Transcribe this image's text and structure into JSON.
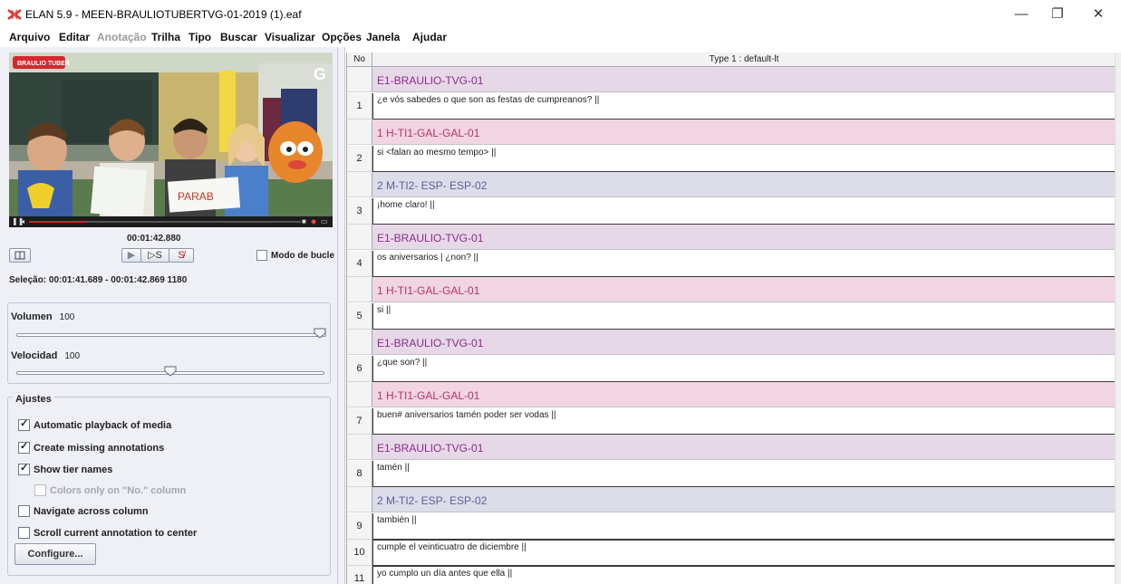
{
  "window": {
    "title": "ELAN 5.9 - MEEN-BRAULIOTUBERTVG-01-2019 (1).eaf",
    "minimize_glyph": "—",
    "restore_glyph": "❐",
    "close_glyph": "✕"
  },
  "menu": [
    {
      "label": "Arquivo",
      "enabled": true
    },
    {
      "label": "Editar",
      "enabled": true
    },
    {
      "label": "Anotação",
      "enabled": false
    },
    {
      "label": "Trilha",
      "enabled": true
    },
    {
      "label": "Tipo",
      "enabled": true
    },
    {
      "label": "Buscar",
      "enabled": true
    },
    {
      "label": "Visualizar",
      "enabled": true
    },
    {
      "label": "Opções",
      "enabled": true
    },
    {
      "label": "Janela",
      "enabled": true
    },
    {
      "label": "Ajudar",
      "enabled": true
    }
  ],
  "player": {
    "logo_text": "BRAULIO TUBER",
    "corner_logo": "G",
    "sign_text": "PARAB",
    "current_time": "00:01:42.880",
    "play_selection_label": "▷S",
    "clear_selection_label": "S̸",
    "loop_mode_label": "Modo de bucle",
    "loop_mode_checked": false,
    "selection_text": "Seleção: 00:01:41.689 - 00:01:42.869  1180"
  },
  "sliders": {
    "volume": {
      "label": "Volumen",
      "value": "100",
      "fraction": 1.0
    },
    "speed": {
      "label": "Velocidad",
      "value": "100",
      "fraction": 0.5
    }
  },
  "settings": {
    "title": "Ajustes",
    "options": [
      {
        "label": "Automatic playback of media",
        "checked": true,
        "enabled": true
      },
      {
        "label": "Create missing annotations",
        "checked": true,
        "enabled": true
      },
      {
        "label": "Show tier names",
        "checked": true,
        "enabled": true
      },
      {
        "label": "Colors only on \"No.\" column",
        "checked": false,
        "enabled": false
      },
      {
        "label": "Navigate across column",
        "checked": false,
        "enabled": true
      },
      {
        "label": "Scroll current annotation to center",
        "checked": false,
        "enabled": true
      }
    ],
    "configure_label": "Configure..."
  },
  "table": {
    "header_no": "No",
    "header_tier": "Type 1 : default-lt",
    "tier_colors": {
      "E1-BRAULIO-TVG-01": {
        "bg": "#e7d8e8",
        "fg": "#8a2c8c"
      },
      "1 H-TI1-GAL-GAL-01": {
        "bg": "#f2d5e2",
        "fg": "#b5346d"
      },
      "2 M-TI2- ESP- ESP-02": {
        "bg": "#dcdde9",
        "fg": "#5d5e9a"
      }
    },
    "rows": [
      {
        "kind": "tier",
        "text": "E1-BRAULIO-TVG-01"
      },
      {
        "kind": "ann",
        "no": "1",
        "text": "¿e vós sabedes o que son as festas de cumpreanos? ||"
      },
      {
        "kind": "tier",
        "text": "1 H-TI1-GAL-GAL-01"
      },
      {
        "kind": "ann",
        "no": "2",
        "text": "si <falan ao mesmo tempo> ||"
      },
      {
        "kind": "tier",
        "text": "2 M-TI2- ESP- ESP-02"
      },
      {
        "kind": "ann",
        "no": "3",
        "text": "¡home claro! ||"
      },
      {
        "kind": "tier",
        "text": "E1-BRAULIO-TVG-01"
      },
      {
        "kind": "ann",
        "no": "4",
        "text": "os aniversarios | ¿non? ||"
      },
      {
        "kind": "tier",
        "text": "1 H-TI1-GAL-GAL-01"
      },
      {
        "kind": "ann",
        "no": "5",
        "text": "si ||"
      },
      {
        "kind": "tier",
        "text": "E1-BRAULIO-TVG-01"
      },
      {
        "kind": "ann",
        "no": "6",
        "text": "¿que son? ||"
      },
      {
        "kind": "tier",
        "text": "1 H-TI1-GAL-GAL-01"
      },
      {
        "kind": "ann",
        "no": "7",
        "text": "buen# aniversarios tamén poder ser vodas ||"
      },
      {
        "kind": "tier",
        "text": "E1-BRAULIO-TVG-01"
      },
      {
        "kind": "ann",
        "no": "8",
        "text": "tamén ||"
      },
      {
        "kind": "tier",
        "text": "2 M-TI2- ESP- ESP-02"
      },
      {
        "kind": "ann",
        "no": "9",
        "text": "también ||"
      },
      {
        "kind": "ann",
        "no": "10",
        "text": "cumple el veinticuatro de diciembre ||"
      },
      {
        "kind": "ann",
        "no": "11",
        "text": "yo cumplo un día antes que ella ||"
      }
    ]
  }
}
